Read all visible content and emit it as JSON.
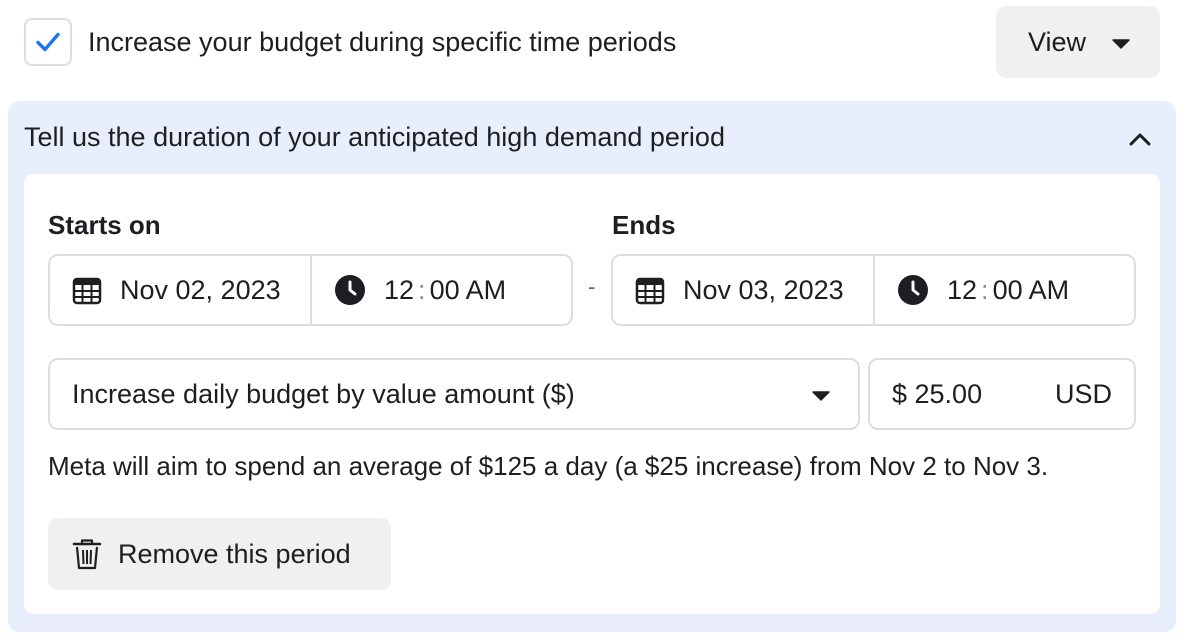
{
  "top": {
    "checkbox_checked": true,
    "checkbox_label": "Increase your budget during specific time periods",
    "view_button": "View"
  },
  "panel": {
    "title": "Tell us the duration of your anticipated high demand period",
    "starts": {
      "label": "Starts on",
      "date": "Nov 02, 2023",
      "hour": "12",
      "minute_ampm": "00 AM"
    },
    "ends": {
      "label": "Ends",
      "date": "Nov 03, 2023",
      "hour": "12",
      "minute_ampm": "00 AM"
    },
    "separator": "-",
    "time_colon": ":",
    "budget_select": "Increase daily budget by value amount ($)",
    "amount": "$ 25.00",
    "currency": "USD",
    "info_text": "Meta will aim to spend an average of $125 a day (a $25 increase) from Nov 2 to Nov 3.",
    "remove_button": "Remove this period"
  },
  "colors": {
    "accent": "#1877f2",
    "panel_bg": "#e8eefb",
    "border": "#dadde1",
    "button_bg": "#f0f0f0",
    "text": "#1c1e21"
  },
  "icons": [
    "checkmark-icon",
    "caret-down-icon",
    "chevron-up-icon",
    "calendar-icon",
    "clock-icon",
    "trash-icon"
  ]
}
